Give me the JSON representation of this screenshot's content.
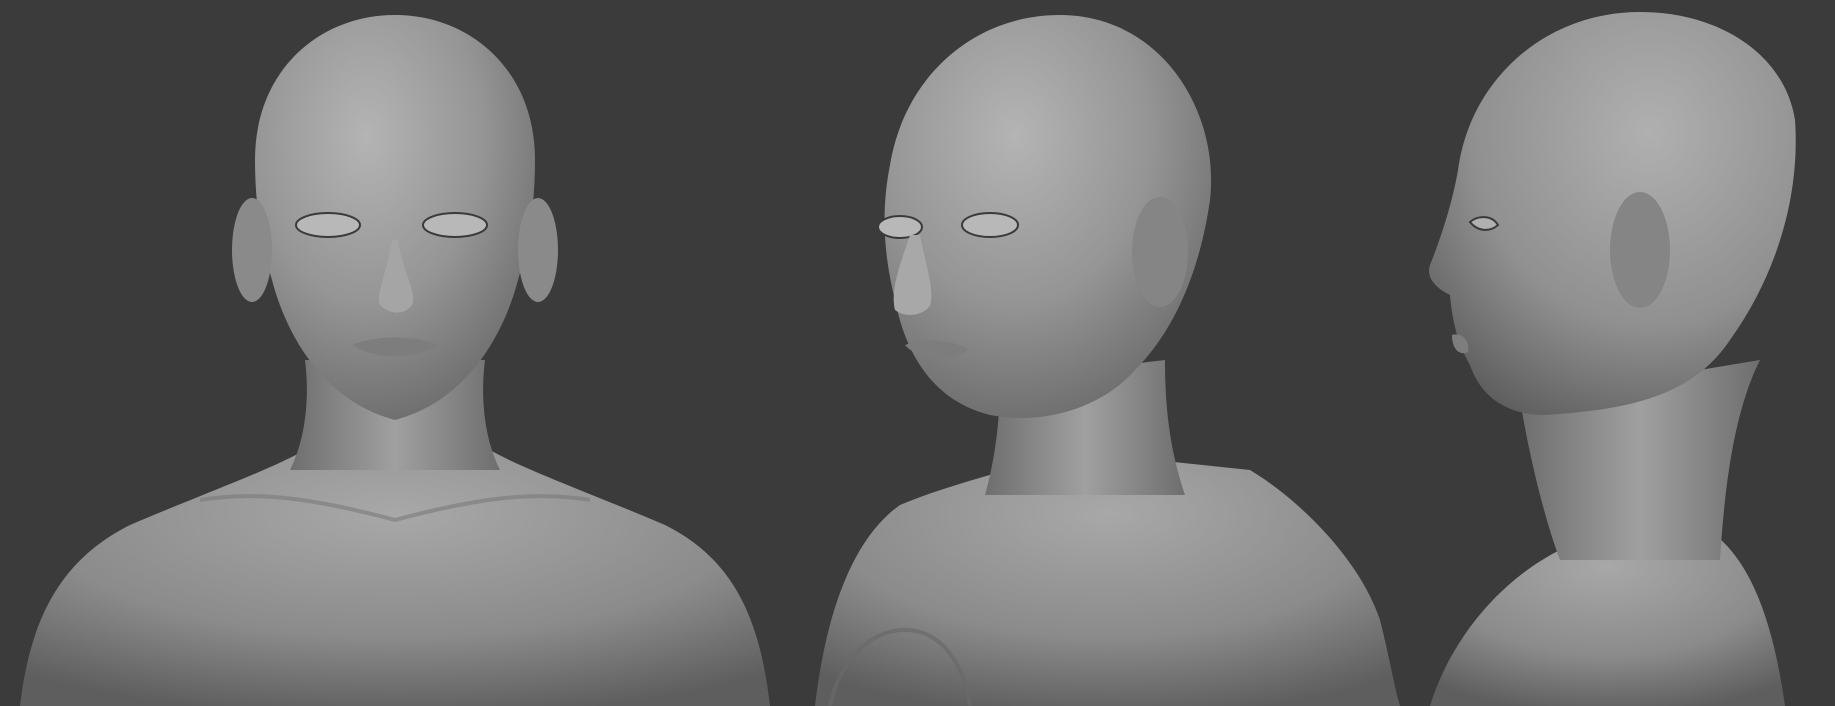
{
  "scene": {
    "description_free": true,
    "background_color": "#3b3b3b",
    "material_color": "#9a9a9a",
    "views": [
      {
        "name": "front"
      },
      {
        "name": "three-quarter"
      },
      {
        "name": "profile"
      }
    ]
  }
}
